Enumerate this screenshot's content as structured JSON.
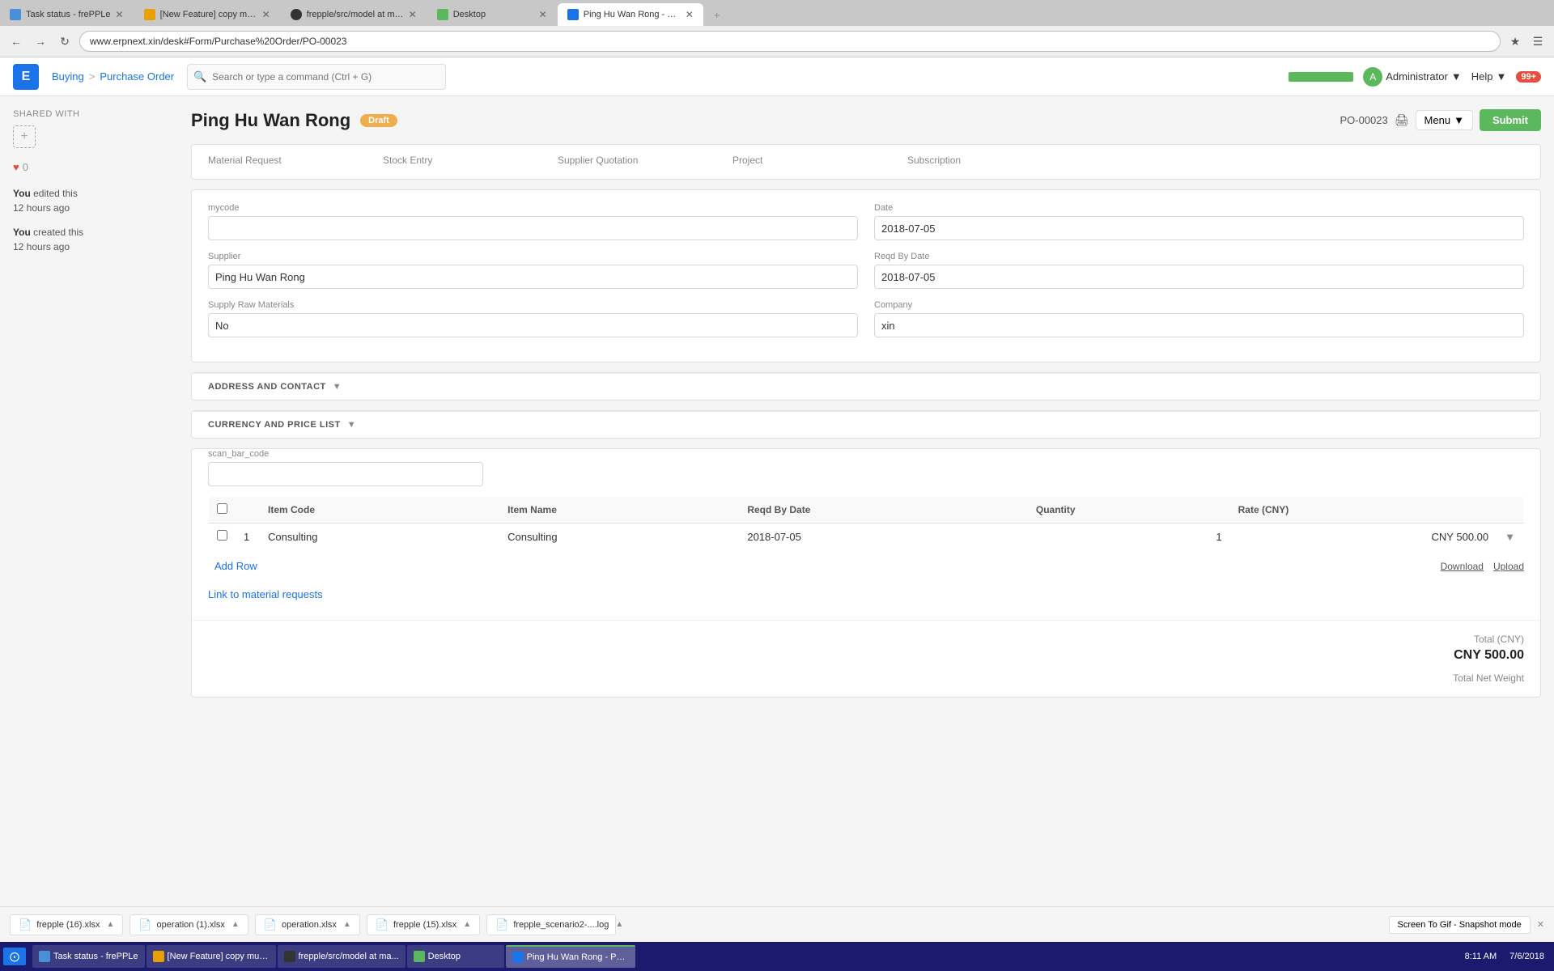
{
  "browser": {
    "address": "www.erpnext.xin/desk#Form/Purchase%20Order/PO-00023",
    "tabs": [
      {
        "id": "tab1",
        "label": "Task status - frePPLe",
        "active": false,
        "favicon_color": "#4a90d9"
      },
      {
        "id": "tab2",
        "label": "[New Feature] copy mult...",
        "active": false,
        "favicon_color": "#e8a000"
      },
      {
        "id": "tab3",
        "label": "frepple/src/model at mas...",
        "active": false,
        "favicon_color": "#333"
      },
      {
        "id": "tab4",
        "label": "Desktop",
        "active": false,
        "favicon_color": "#5cb85c"
      },
      {
        "id": "tab5",
        "label": "Ping Hu Wan Rong - PC...",
        "active": true,
        "favicon_color": "#1a73e8"
      }
    ]
  },
  "app": {
    "logo": "E",
    "breadcrumb": {
      "buying": "Buying",
      "sep": ">",
      "purchase_order": "Purchase Order"
    },
    "search_placeholder": "Search or type a command (Ctrl + G)",
    "admin_label": "Administrator",
    "help_label": "Help",
    "notification_count": "99+"
  },
  "document": {
    "title": "Ping Hu Wan Rong",
    "status": "Draft",
    "po_number": "PO-00023",
    "menu_label": "Menu",
    "submit_label": "Submit"
  },
  "sidebar": {
    "shared_with_label": "SHARED WITH",
    "add_btn": "+",
    "like_count": "0",
    "timeline": [
      {
        "id": "t1",
        "actor": "You",
        "action": "edited this",
        "time": "12 hours ago"
      },
      {
        "id": "t2",
        "actor": "You",
        "action": "created this",
        "time": "12 hours ago"
      }
    ]
  },
  "links": {
    "material_request_label": "Material Request",
    "material_request_value": "",
    "stock_entry_label": "Stock Entry",
    "stock_entry_value": "",
    "supplier_quotation_label": "Supplier Quotation",
    "supplier_quotation_value": "",
    "project_label": "Project",
    "project_value": "",
    "subscription_label": "Subscription",
    "subscription_value": ""
  },
  "form": {
    "mycode_label": "mycode",
    "mycode_value": "",
    "date_label": "Date",
    "date_value": "2018-07-05",
    "supplier_label": "Supplier",
    "supplier_value": "Ping Hu Wan Rong",
    "reqd_by_date_label": "Reqd By Date",
    "reqd_by_date_value": "2018-07-05",
    "supply_raw_materials_label": "Supply Raw Materials",
    "supply_raw_materials_value": "No",
    "company_label": "Company",
    "company_value": "xin"
  },
  "sections": {
    "address_contact_label": "ADDRESS AND CONTACT",
    "currency_price_list_label": "CURRENCY AND PRICE LIST"
  },
  "table": {
    "scan_bar_code_label": "scan_bar_code",
    "scan_bar_code_value": "",
    "columns": [
      {
        "id": "col_check",
        "label": ""
      },
      {
        "id": "col_num",
        "label": ""
      },
      {
        "id": "col_item_code",
        "label": "Item Code"
      },
      {
        "id": "col_item_name",
        "label": "Item Name"
      },
      {
        "id": "col_reqd_by_date",
        "label": "Reqd By Date"
      },
      {
        "id": "col_qty",
        "label": "Quantity"
      },
      {
        "id": "col_rate",
        "label": "Rate (CNY)"
      },
      {
        "id": "col_actions",
        "label": ""
      }
    ],
    "rows": [
      {
        "num": "1",
        "item_code": "Consulting",
        "item_name": "Consulting",
        "reqd_by_date": "2018-07-05",
        "quantity": "1",
        "rate": "CNY 500.00"
      }
    ],
    "add_row_label": "Add Row",
    "download_label": "Download",
    "upload_label": "Upload",
    "link_material_label": "Link to material requests"
  },
  "totals": {
    "total_label": "Total (CNY)",
    "total_value": "CNY 500.00",
    "total_net_weight_label": "Total Net Weight"
  },
  "download_bar": {
    "items": [
      {
        "id": "dl1",
        "label": "frepple (16).xlsx",
        "icon": "xlsx"
      },
      {
        "id": "dl2",
        "label": "operation (1).xlsx",
        "icon": "xlsx"
      },
      {
        "id": "dl3",
        "label": "operation.xlsx",
        "icon": "xlsx"
      },
      {
        "id": "dl4",
        "label": "frepple (15).xlsx",
        "icon": "xlsx"
      },
      {
        "id": "dl5",
        "label": "frepple_scenario2-....log",
        "icon": "log"
      }
    ],
    "screen_gif_label": "Screen To Gif - Snapshot mode"
  },
  "taskbar": {
    "items": [
      {
        "id": "tb1",
        "label": "Task status - frePPLe",
        "active": false
      },
      {
        "id": "tb2",
        "label": "[New Feature] copy mult...",
        "active": false
      },
      {
        "id": "tb3",
        "label": "frepple/src/model at ma...",
        "active": false
      },
      {
        "id": "tb4",
        "label": "Desktop",
        "active": false
      },
      {
        "id": "tb5",
        "label": "Ping Hu Wan Rong - PC...",
        "active": true
      }
    ],
    "time": "8:11 AM",
    "date": "7/6/2018"
  }
}
